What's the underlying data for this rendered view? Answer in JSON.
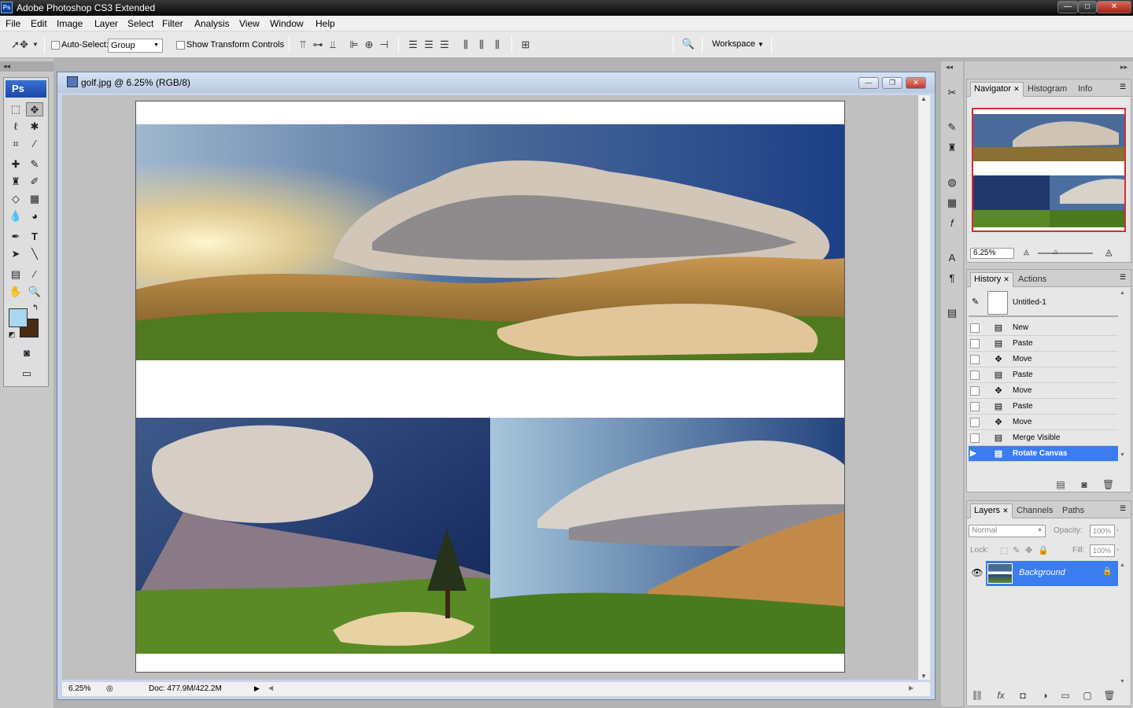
{
  "app": {
    "title": "Adobe Photoshop CS3 Extended",
    "logo": "Ps"
  },
  "window_controls": {
    "minimize": "—",
    "maximize": "□",
    "close": "✕"
  },
  "menu": [
    "File",
    "Edit",
    "Image",
    "Layer",
    "Select",
    "Filter",
    "Analysis",
    "View",
    "Window",
    "Help"
  ],
  "options": {
    "auto_select_label": "Auto-Select:",
    "auto_select_value": "Group",
    "transform_label": "Show Transform Controls",
    "workspace_label": "Workspace"
  },
  "tools": {
    "header": "Ps",
    "foreground_color": "#a9d7f0",
    "background_color": "#4a2a12"
  },
  "document": {
    "title": "golf.jpg @ 6.25% (RGB/8)",
    "zoom": "6.25%",
    "doc_size": "Doc: 477.9M/422.2M"
  },
  "navigator": {
    "tabs": [
      "Navigator",
      "Histogram",
      "Info"
    ],
    "zoom": "6.25%"
  },
  "history": {
    "tabs": [
      "History",
      "Actions"
    ],
    "snapshot": "Untitled-1",
    "items": [
      {
        "icon": "document-icon",
        "label": "New"
      },
      {
        "icon": "document-icon",
        "label": "Paste"
      },
      {
        "icon": "move-icon",
        "label": "Move"
      },
      {
        "icon": "document-icon",
        "label": "Paste"
      },
      {
        "icon": "move-icon",
        "label": "Move"
      },
      {
        "icon": "document-icon",
        "label": "Paste"
      },
      {
        "icon": "move-icon",
        "label": "Move"
      },
      {
        "icon": "document-icon",
        "label": "Merge Visible"
      },
      {
        "icon": "document-icon",
        "label": "Rotate Canvas"
      }
    ],
    "selected_index": 8
  },
  "layers": {
    "tabs": [
      "Layers",
      "Channels",
      "Paths"
    ],
    "blend_mode": "Normal",
    "opacity_label": "Opacity:",
    "opacity": "100%",
    "lock_label": "Lock:",
    "fill_label": "Fill:",
    "fill": "100%",
    "items": [
      {
        "name": "Background",
        "visible": true,
        "locked": true
      }
    ]
  },
  "colors": {
    "selection": "#3b7cf0",
    "titlebar": "#111111",
    "accent": "#1a48a8"
  }
}
